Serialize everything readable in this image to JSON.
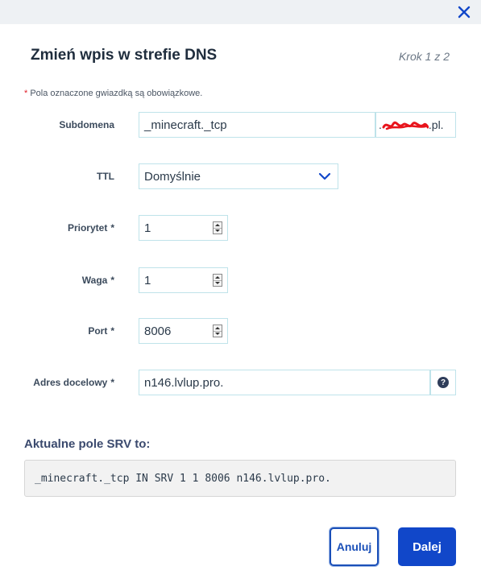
{
  "dialog": {
    "title": "Zmień wpis w strefie DNS",
    "step": "Krok 1 z 2",
    "required_note_star": "*",
    "required_note": "Pola oznaczone gwiazdką są obowiązkowe."
  },
  "fields": {
    "subdomain": {
      "label": "Subdomena",
      "value": "_minecraft._tcp",
      "suffix_prefix": ".",
      "suffix_end": ".pl."
    },
    "ttl": {
      "label": "TTL",
      "value": "Domyślnie"
    },
    "priority": {
      "label": "Priorytet",
      "required": "*",
      "value": "1"
    },
    "weight": {
      "label": "Waga",
      "required": "*",
      "value": "1"
    },
    "port": {
      "label": "Port",
      "required": "*",
      "value": "8006"
    },
    "target": {
      "label": "Adres docelowy",
      "required": "*",
      "value": "n146.lvlup.pro.",
      "help": "?"
    }
  },
  "srv": {
    "heading": "Aktualne pole SRV to:",
    "record": "_minecraft._tcp IN SRV 1 1 8006 n146.lvlup.pro."
  },
  "buttons": {
    "cancel": "Anuluj",
    "next": "Dalej"
  },
  "colors": {
    "primary": "#1147c9",
    "field_border": "#bfe3ea",
    "required_star": "#e0202a",
    "topbar": "#eef1f4"
  },
  "icons": {
    "close": "close-icon",
    "select": "chevron-down-icon",
    "help": "question-icon",
    "spinner": "spinner-icon"
  }
}
